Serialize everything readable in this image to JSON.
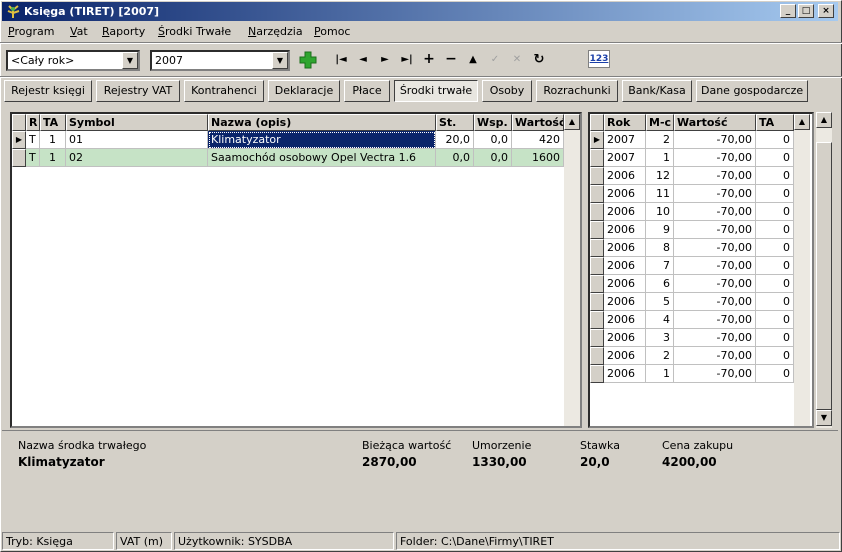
{
  "window": {
    "title": "Księga (TIRET) [2007]"
  },
  "menu": [
    "Program",
    "Vat",
    "Raporty",
    "Środki Trwałe",
    "Narzędzia",
    "Pomoc"
  ],
  "toolbar": {
    "period": "<Cały rok>",
    "year": "2007",
    "icons": [
      "add-icon",
      "first-icon",
      "prev-icon",
      "next-icon",
      "last-icon",
      "insert-icon",
      "delete-icon",
      "up-icon",
      "confirm-icon",
      "cancel-icon",
      "refresh-icon",
      "calculator-icon"
    ],
    "calc_label": "123"
  },
  "tabs": [
    "Rejestr księgi",
    "Rejestry VAT",
    "Kontrahenci",
    "Deklaracje",
    "Płace",
    "Środki trwałe",
    "Osoby",
    "Rozrachunki",
    "Bank/Kasa",
    "Dane gospodarcze"
  ],
  "active_tab": "Środki trwałe",
  "assets": {
    "headers": [
      "R",
      "TA",
      "Symbol",
      "Nazwa (opis)",
      "St.",
      "Wsp.",
      "Wartość"
    ],
    "rows": [
      [
        "T",
        "1",
        "01",
        "Klimatyzator",
        "20,0",
        "0,0",
        "420"
      ],
      [
        "T",
        "1",
        "02",
        "Saamochód osobowy Opel Vectra 1.6",
        "0,0",
        "0,0",
        "1600"
      ]
    ]
  },
  "history": {
    "headers": [
      "Rok",
      "M-c",
      "Wartość",
      "TA"
    ],
    "rows": [
      [
        "2007",
        "2",
        "-70,00",
        "0"
      ],
      [
        "2007",
        "1",
        "-70,00",
        "0"
      ],
      [
        "2006",
        "12",
        "-70,00",
        "0"
      ],
      [
        "2006",
        "11",
        "-70,00",
        "0"
      ],
      [
        "2006",
        "10",
        "-70,00",
        "0"
      ],
      [
        "2006",
        "9",
        "-70,00",
        "0"
      ],
      [
        "2006",
        "8",
        "-70,00",
        "0"
      ],
      [
        "2006",
        "7",
        "-70,00",
        "0"
      ],
      [
        "2006",
        "6",
        "-70,00",
        "0"
      ],
      [
        "2006",
        "5",
        "-70,00",
        "0"
      ],
      [
        "2006",
        "4",
        "-70,00",
        "0"
      ],
      [
        "2006",
        "3",
        "-70,00",
        "0"
      ],
      [
        "2006",
        "2",
        "-70,00",
        "0"
      ],
      [
        "2006",
        "1",
        "-70,00",
        "0"
      ]
    ]
  },
  "details": {
    "name_label": "Nazwa środka trwałego",
    "name_value": "Klimatyzator",
    "current_label": "Bieżąca wartość",
    "current_value": "2870,00",
    "depreciation_label": "Umorzenie",
    "depreciation_value": "1330,00",
    "rate_label": "Stawka",
    "rate_value": "20,0",
    "price_label": "Cena zakupu",
    "price_value": "4200,00"
  },
  "status": {
    "mode": "Tryb: Księga",
    "vat": "VAT (m)",
    "user": "Użytkownik: SYSDBA",
    "folder": "Folder: C:\\Dane\\Firmy\\TIRET"
  },
  "colors": {
    "title_start": "#0a246a",
    "selected_row": "#0a246a",
    "row_alt": "#c6e3c6",
    "add_green": "#2fa52f"
  }
}
